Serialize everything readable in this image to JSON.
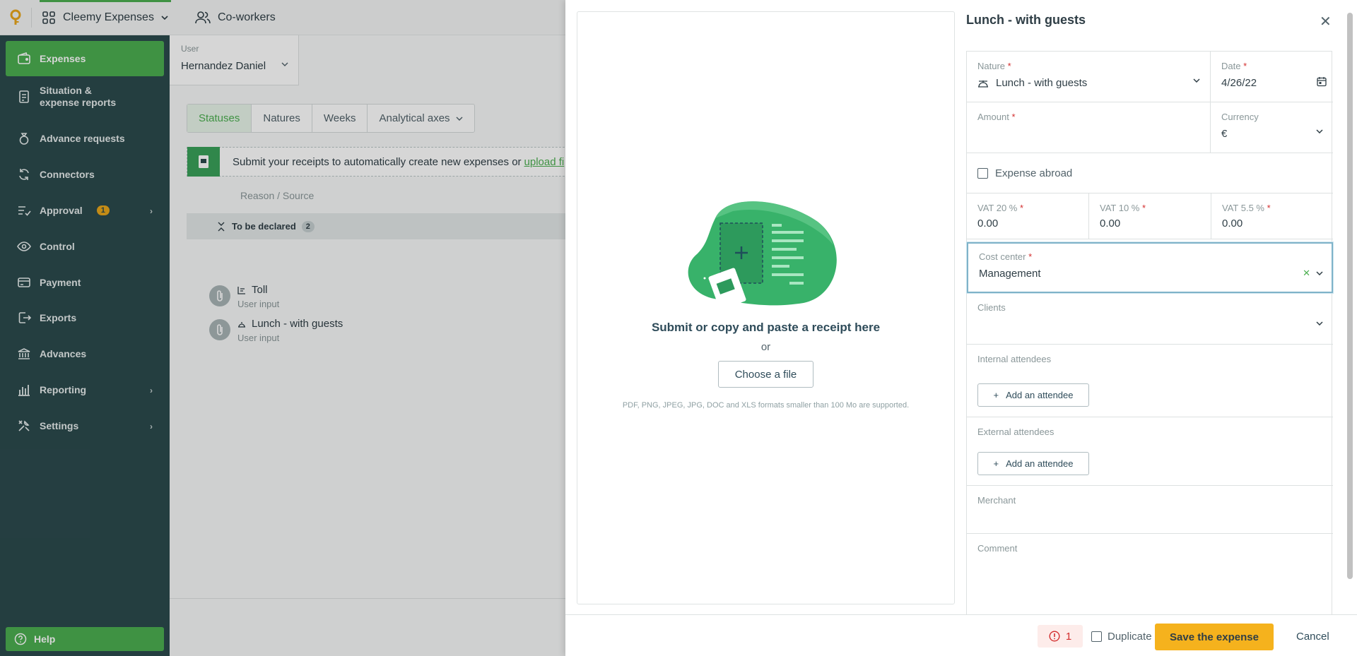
{
  "topbar": {
    "app_name": "Cleemy Expenses",
    "coworkers": "Co-workers"
  },
  "sidebar": {
    "items": [
      {
        "label": "Expenses"
      },
      {
        "label": "Situation & expense reports"
      },
      {
        "label": "Advance requests"
      },
      {
        "label": "Connectors"
      },
      {
        "label": "Approval",
        "badge": "1"
      },
      {
        "label": "Control"
      },
      {
        "label": "Payment"
      },
      {
        "label": "Exports"
      },
      {
        "label": "Advances"
      },
      {
        "label": "Reporting"
      },
      {
        "label": "Settings"
      }
    ],
    "help": "Help"
  },
  "main": {
    "user_label": "User",
    "user_value": "Hernandez Daniel",
    "tabs": [
      "Statuses",
      "Natures",
      "Weeks",
      "Analytical axes"
    ],
    "banner_text": "Submit your receipts to automatically create new expenses or",
    "banner_link": "upload fi",
    "list_header": "Reason / Source",
    "group_label": "To be declared",
    "group_count": "2",
    "rows": [
      {
        "title": "Toll",
        "source": "User input"
      },
      {
        "title": "Lunch - with guests",
        "source": "User input"
      }
    ]
  },
  "panel": {
    "title": "Lunch - with guests",
    "dropzone": {
      "title": "Submit or copy and paste a receipt here",
      "or": "or",
      "button": "Choose a file",
      "formats": "PDF, PNG, JPEG, JPG, DOC and XLS formats smaller than 100 Mo are supported."
    },
    "form": {
      "nature_label": "Nature",
      "nature_value": "Lunch - with guests",
      "date_label": "Date",
      "date_value": "4/26/22",
      "amount_label": "Amount",
      "currency_label": "Currency",
      "currency_value": "€",
      "abroad_label": "Expense abroad",
      "vat20_label": "VAT 20 %",
      "vat20_value": "0.00",
      "vat10_label": "VAT 10 %",
      "vat10_value": "0.00",
      "vat55_label": "VAT 5.5 %",
      "vat55_value": "0.00",
      "cost_center_label": "Cost center",
      "cost_center_value": "Management",
      "clients_label": "Clients",
      "internal_label": "Internal attendees",
      "external_label": "External attendees",
      "add_attendee": "Add an attendee",
      "merchant_label": "Merchant",
      "comment_label": "Comment",
      "required_mark": "*"
    },
    "footer": {
      "error_count": "1",
      "duplicate": "Duplicate",
      "save": "Save the expense",
      "cancel": "Cancel"
    }
  },
  "colors": {
    "sidebar": "#2c4a4d",
    "accent": "#4caf50",
    "save": "#f5b21d",
    "error": "#d32f2f"
  }
}
